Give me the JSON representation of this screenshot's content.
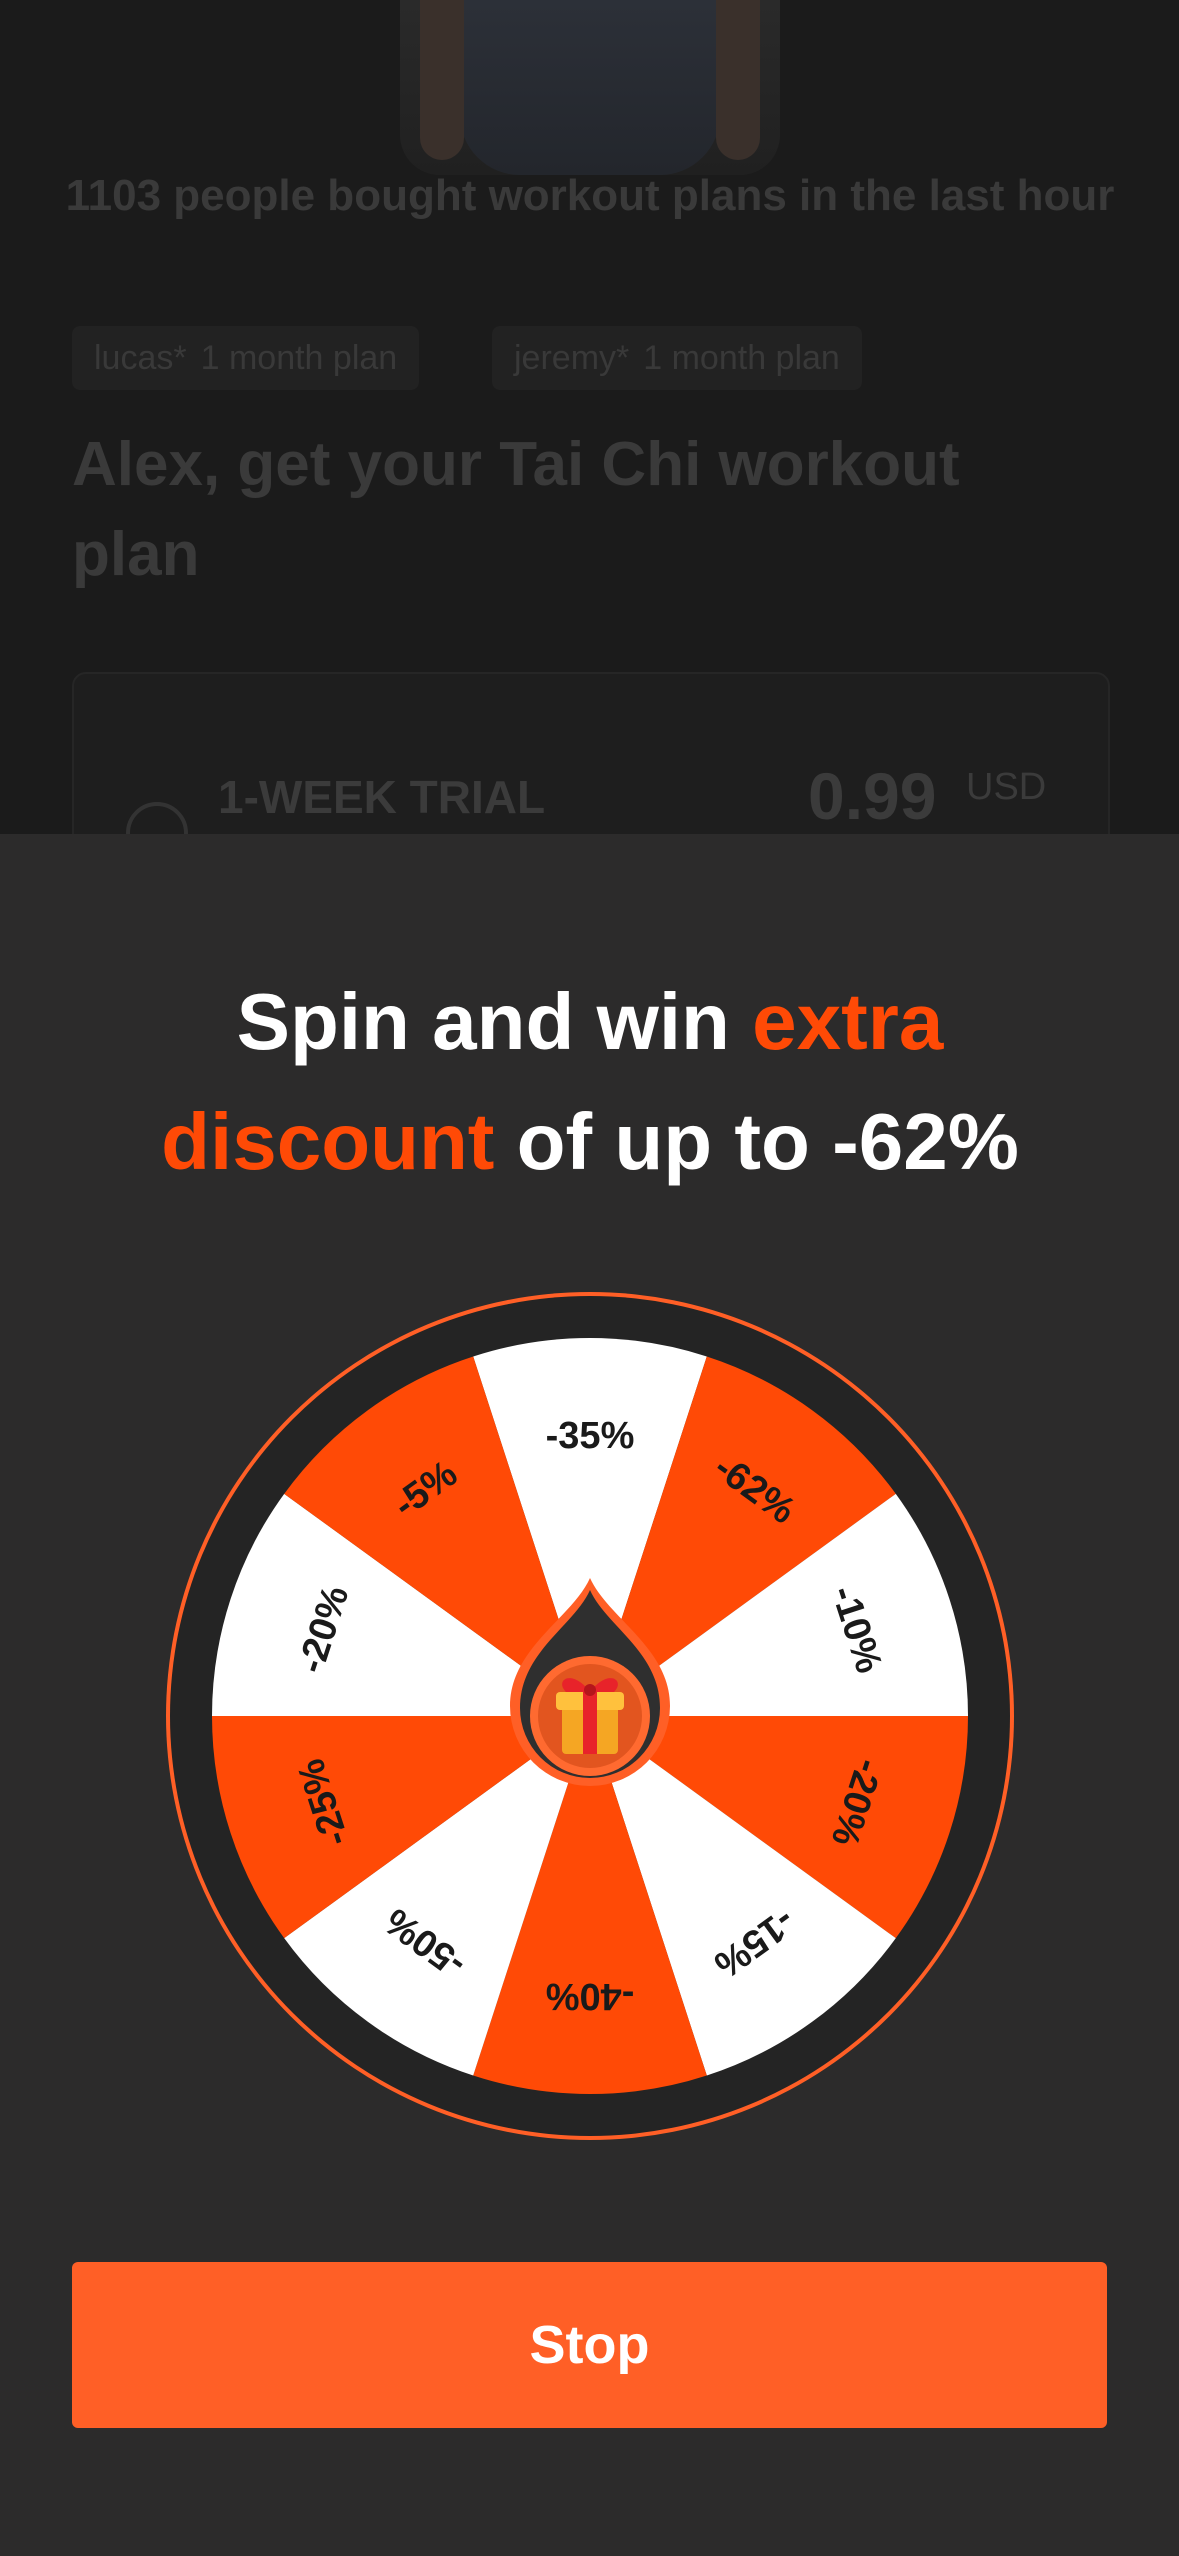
{
  "background_page": {
    "social_proof": "1103 people bought workout plans in the last hour",
    "chips": [
      {
        "name": "lucas*",
        "plan": "1 month plan"
      },
      {
        "name": "jeremy*",
        "plan": "1 month plan"
      }
    ],
    "heading": "Alex, get your Tai Chi workout plan",
    "plan": {
      "name": "1-WEEK TRIAL",
      "price": "0.99",
      "currency": "USD"
    }
  },
  "sheet": {
    "title_part1": "Spin and win ",
    "title_accent": "extra discount",
    "title_part2": " of up to -62%"
  },
  "wheel": {
    "segments": [
      {
        "label": "-35%",
        "color": "white"
      },
      {
        "label": "-62%",
        "color": "orange"
      },
      {
        "label": "-10%",
        "color": "white"
      },
      {
        "label": "-20%",
        "color": "orange"
      },
      {
        "label": "-15%",
        "color": "white"
      },
      {
        "label": "-40%",
        "color": "orange"
      },
      {
        "label": "-50%",
        "color": "white"
      },
      {
        "label": "-25%",
        "color": "orange"
      },
      {
        "label": "-20%",
        "color": "white"
      },
      {
        "label": "-5%",
        "color": "orange"
      }
    ],
    "center_icon": "gift-icon"
  },
  "actions": {
    "stop_label": "Stop"
  },
  "colors": {
    "accent": "#ff4a06",
    "button": "#ff5f26",
    "wheel_orange": "#ff4a06",
    "wheel_white": "#ffffff",
    "sheet_bg": "#2c2b2b"
  }
}
